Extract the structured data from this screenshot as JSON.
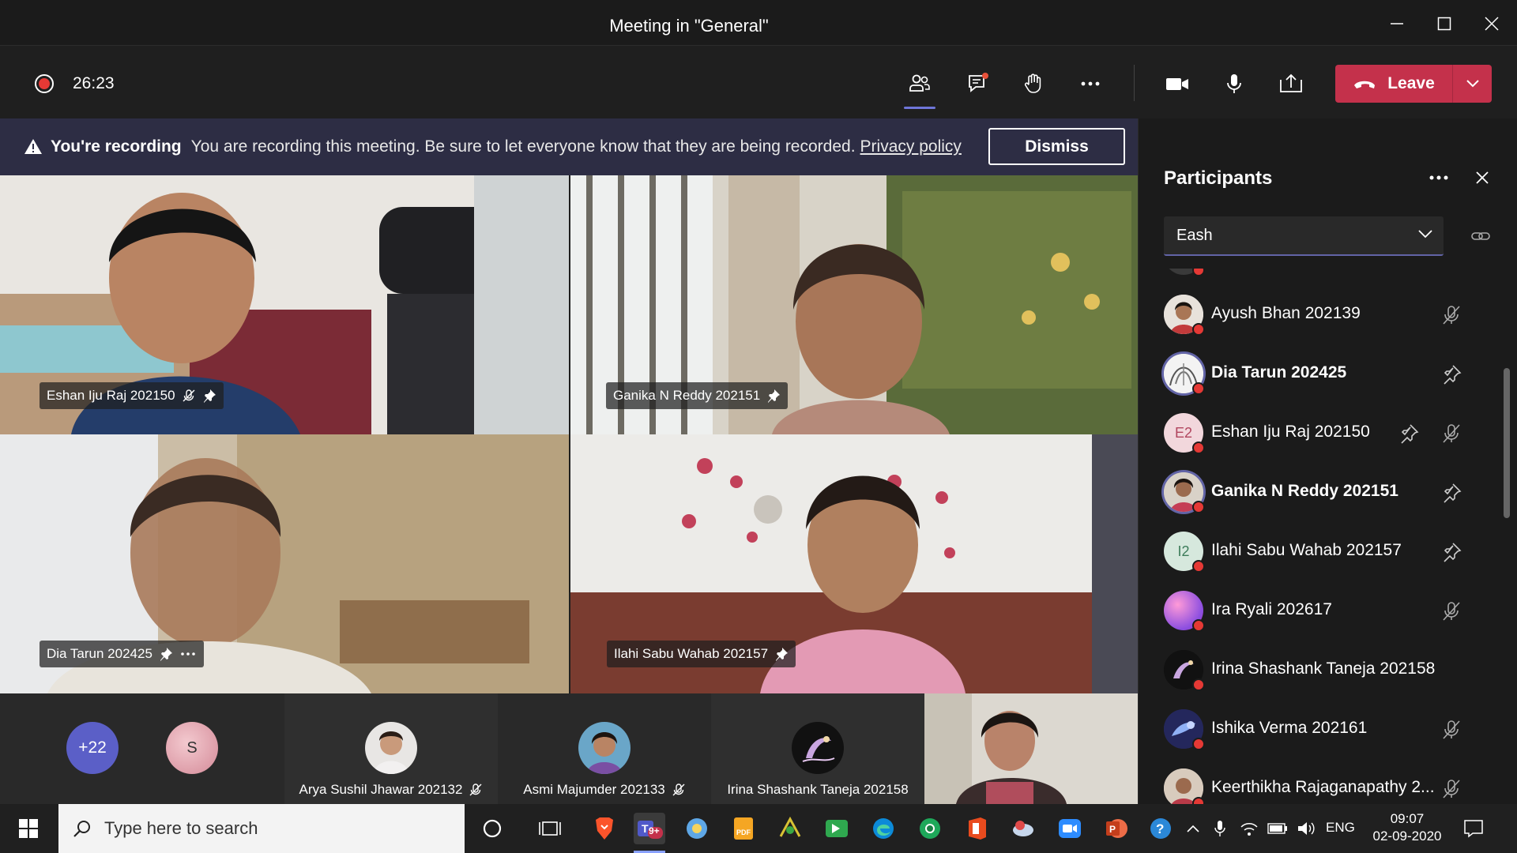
{
  "window": {
    "title": "Meeting in \"General\""
  },
  "controls": {
    "timer": "26:23",
    "leave_label": "Leave"
  },
  "banner": {
    "title": "You're recording",
    "text": "You are recording this meeting. Be sure to let everyone know that they are being recorded.",
    "link": "Privacy policy",
    "dismiss": "Dismiss"
  },
  "videos": [
    {
      "name": "Eshan Iju Raj 202150"
    },
    {
      "name": "Ganika N Reddy 202151"
    },
    {
      "name": "Dia Tarun 202425"
    },
    {
      "name": "Ilahi Sabu Wahab 202157"
    }
  ],
  "strip": {
    "overflow": "+22",
    "s_initial": "S",
    "people": [
      {
        "name": "Arya Sushil Jhawar 202132"
      },
      {
        "name": "Asmi Majumder 202133"
      },
      {
        "name": "Irina Shashank Taneja 202158"
      }
    ]
  },
  "panel": {
    "title": "Participants",
    "search_value": "Eash",
    "participants": [
      {
        "name": "Ayush Bhan 202139",
        "initials": "",
        "bold": false
      },
      {
        "name": "Dia Tarun 202425",
        "initials": "",
        "bold": true
      },
      {
        "name": "Eshan Iju Raj 202150",
        "initials": "E2",
        "bold": false
      },
      {
        "name": "Ganika N Reddy 202151",
        "initials": "",
        "bold": true
      },
      {
        "name": "Ilahi Sabu Wahab 202157",
        "initials": "I2",
        "bold": false
      },
      {
        "name": "Ira Ryali 202617",
        "initials": "",
        "bold": false
      },
      {
        "name": "Irina Shashank Taneja 202158",
        "initials": "",
        "bold": false
      },
      {
        "name": "Ishika Verma 202161",
        "initials": "",
        "bold": false
      },
      {
        "name": "Keerthikha Rajaganapathy 2...",
        "initials": "",
        "bold": false
      }
    ]
  },
  "taskbar": {
    "search_placeholder": "Type here to search",
    "teams_badge": "9+",
    "lang": "ENG",
    "time": "09:07",
    "date": "02-09-2020"
  },
  "colors": {
    "accent": "#6264a7",
    "leave": "#c4314b",
    "banner": "#2d2d44",
    "recording": "#e53935"
  }
}
